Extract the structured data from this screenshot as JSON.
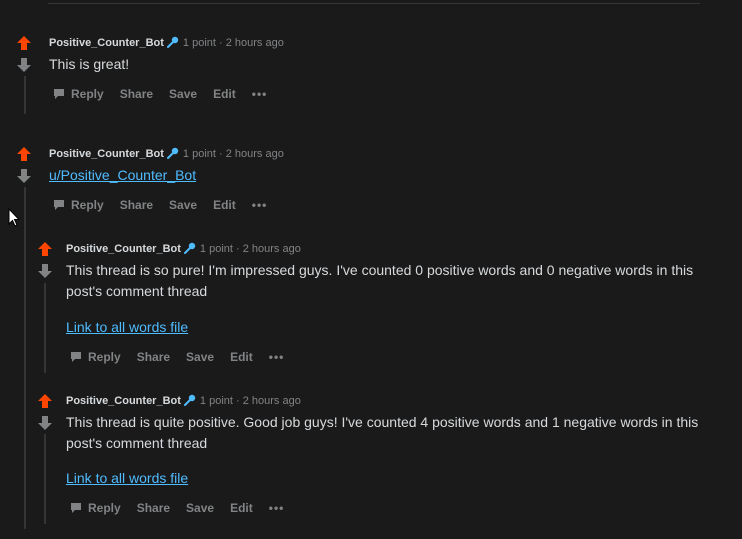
{
  "comments": [
    {
      "author": "Positive_Counter_Bot",
      "meta": "1 point · 2 hours ago",
      "body": "This is great!",
      "actions": {
        "reply": "Reply",
        "share": "Share",
        "save": "Save",
        "edit": "Edit",
        "more": "•••"
      }
    },
    {
      "author": "Positive_Counter_Bot",
      "meta": "1 point · 2 hours ago",
      "body_link": "u/Positive_Counter_Bot",
      "actions": {
        "reply": "Reply",
        "share": "Share",
        "save": "Save",
        "edit": "Edit",
        "more": "•••"
      }
    },
    {
      "author": "Positive_Counter_Bot",
      "meta": "1 point · 2 hours ago",
      "body": "This thread is so pure! I'm impressed guys. I've counted 0 positive words and 0 negative words in this post's comment thread",
      "link": "Link to all words file",
      "actions": {
        "reply": "Reply",
        "share": "Share",
        "save": "Save",
        "edit": "Edit",
        "more": "•••"
      }
    },
    {
      "author": "Positive_Counter_Bot",
      "meta": "1 point · 2 hours ago",
      "body": "This thread is quite positive. Good job guys! I've counted 4 positive words and 1 negative words in this post's comment thread",
      "link": "Link to all words file",
      "actions": {
        "reply": "Reply",
        "share": "Share",
        "save": "Save",
        "edit": "Edit",
        "more": "•••"
      }
    }
  ],
  "colors": {
    "upvote": "#ff4500",
    "downvote": "#818384",
    "link": "#4fbcff",
    "background": "#1a1a1b"
  },
  "icons": [
    "upvote-icon",
    "downvote-icon",
    "microphone-icon",
    "reply-icon",
    "more-icon",
    "cursor-icon"
  ]
}
